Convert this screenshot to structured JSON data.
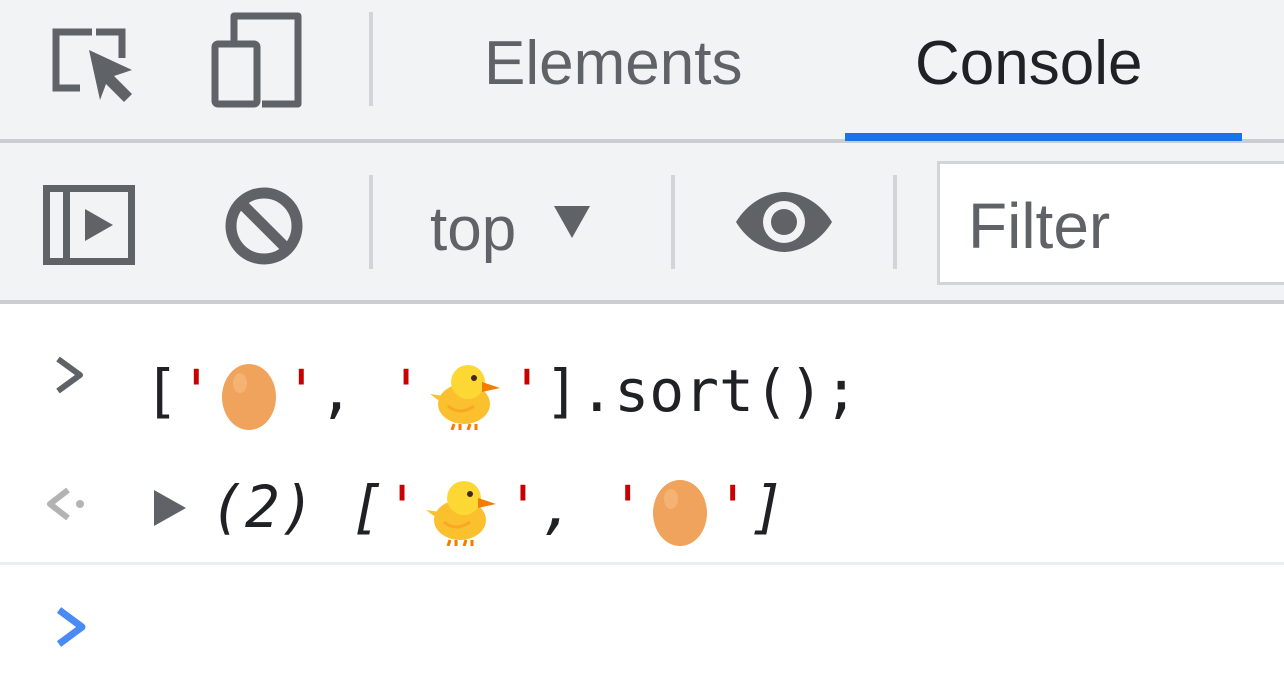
{
  "tabs": [
    {
      "label": "Elements",
      "active": false
    },
    {
      "label": "Console",
      "active": true
    }
  ],
  "toolbar": {
    "context": "top",
    "filter_placeholder": "Filter"
  },
  "console": {
    "input": {
      "open": "[",
      "quote": "'",
      "sep": ", ",
      "close": "].sort();",
      "items": [
        "egg",
        "chick"
      ]
    },
    "output": {
      "count": "(2)",
      "open": "[",
      "quote": "'",
      "sep": ", ",
      "close": "]",
      "items": [
        "chick",
        "egg"
      ]
    }
  },
  "icons": {
    "inspect": "inspect-element-icon",
    "device": "device-toolbar-icon",
    "sidebar": "show-sidebar-icon",
    "clear": "clear-console-icon",
    "context_arrow": "dropdown-triangle-icon",
    "eye": "live-expression-eye-icon",
    "input_prompt": "input-chevron-icon",
    "result": "result-arrow-icon",
    "expand": "expand-triangle-icon",
    "new_prompt": "prompt-chevron-icon"
  },
  "colors": {
    "accent": "#1a73e8",
    "toolbar_bg": "#f1f3f4",
    "string_quote": "#c80000",
    "icon_gray": "#5f6368",
    "prompt_blue": "#4a8af4"
  }
}
